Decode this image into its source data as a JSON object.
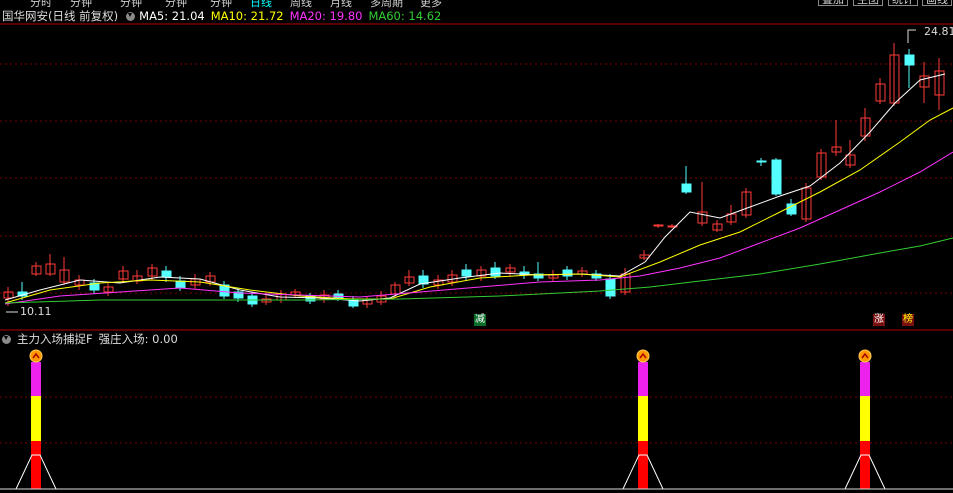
{
  "top_menu": {
    "items": [
      "分时",
      "分钟",
      "分钟",
      "分钟",
      "分钟",
      "日线",
      "周线",
      "月线",
      "多周期",
      "更多"
    ],
    "right_buttons": [
      "叠加",
      "主图",
      "统计",
      "画线"
    ]
  },
  "main_panel": {
    "title": "国华网安(日线 前复权)",
    "ma_labels": [
      {
        "text": "MA5: 21.04",
        "color": "#ffffff"
      },
      {
        "text": "MA10: 21.72",
        "color": "#ffff00"
      },
      {
        "text": "MA20: 19.80",
        "color": "#ff33ff"
      },
      {
        "text": "MA60: 14.62",
        "color": "#33cc33"
      }
    ],
    "price_high": "24.81",
    "price_low": "10.11",
    "signals": [
      {
        "text": "减",
        "bg": "#0a6e2a",
        "fg": "#ffffff"
      },
      {
        "text": "涨",
        "bg": "#7a1010",
        "fg": "#ffffff"
      },
      {
        "text": "榜",
        "bg": "#7a1010",
        "fg": "#ffff00"
      }
    ]
  },
  "sub_panel": {
    "title": "主力入场捕捉F",
    "value_text": "强庄入场: 0.00"
  },
  "colors": {
    "up": "#ff3b3b",
    "down": "#54ffff",
    "grid": "#7a0000"
  }
}
